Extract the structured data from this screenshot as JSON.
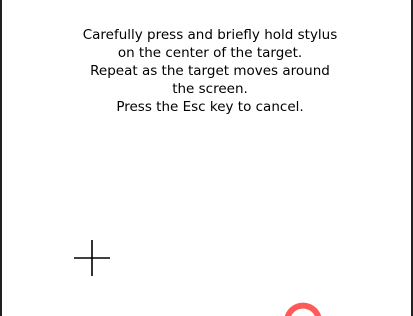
{
  "instructions": {
    "lines": [
      "Carefully press and briefly hold stylus",
      "on the center of the target.",
      "Repeat as the target moves around",
      "the screen.",
      "Press the Esc key to cancel."
    ]
  },
  "target": {
    "icon": "crosshair-icon",
    "color": "#000000"
  },
  "ink_mark": {
    "icon": "partial-circle-mark",
    "color": "#ff4a4a"
  }
}
